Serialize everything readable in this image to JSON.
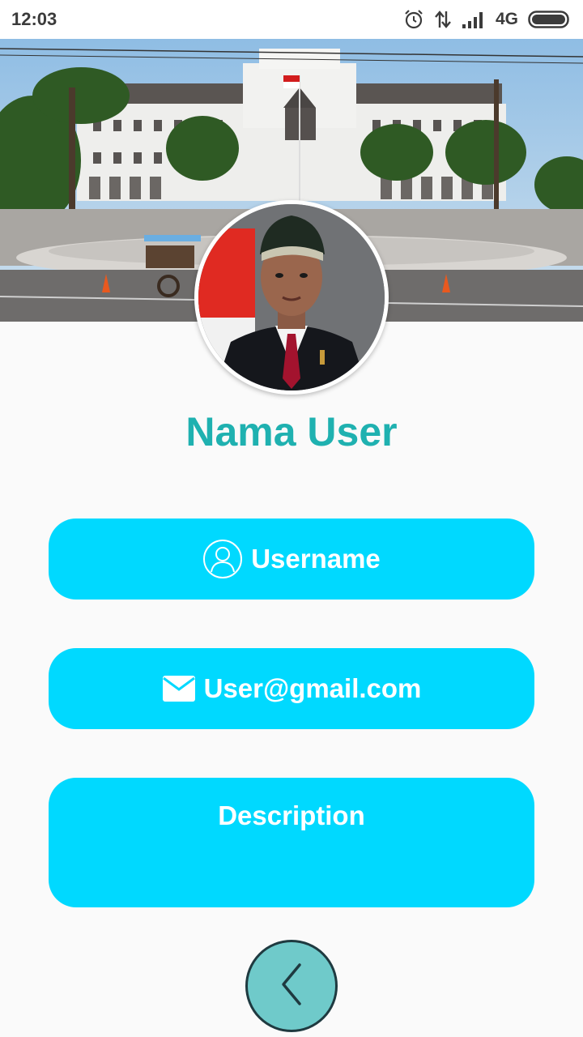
{
  "status_bar": {
    "time": "12:03",
    "network": "4G",
    "icons": [
      "alarm-icon",
      "data-transfer-icon",
      "signal-icon",
      "battery-icon"
    ]
  },
  "header": {
    "image": "building-photo"
  },
  "profile": {
    "avatar": "profile-photo",
    "name": "Nama User"
  },
  "fields": {
    "username_label": "Username",
    "username_icon": "user-icon",
    "email_label": "User@gmail.com",
    "email_icon": "mail-icon",
    "description_label": "Description"
  },
  "navigation": {
    "back_icon": "chevron-left-icon"
  },
  "colors": {
    "accent": "#00d9ff",
    "title": "#1fb1b0",
    "back_button": "#6fcaca",
    "background": "#fafafa"
  }
}
